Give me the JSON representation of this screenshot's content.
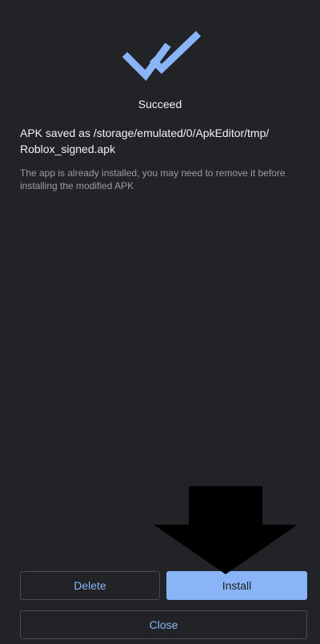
{
  "dialog": {
    "icon": "double-check-icon",
    "title": "Succeed",
    "message": "APK saved as /storage/emulated/0/ApkEditor/tmp/ Roblox_signed.apk",
    "note": "The app is already installed, you may need to remove it before installing the modified APK"
  },
  "buttons": {
    "delete": "Delete",
    "install": "Install",
    "close": "Close"
  },
  "colors": {
    "background": "#222327",
    "accent": "#8ab4f8"
  }
}
